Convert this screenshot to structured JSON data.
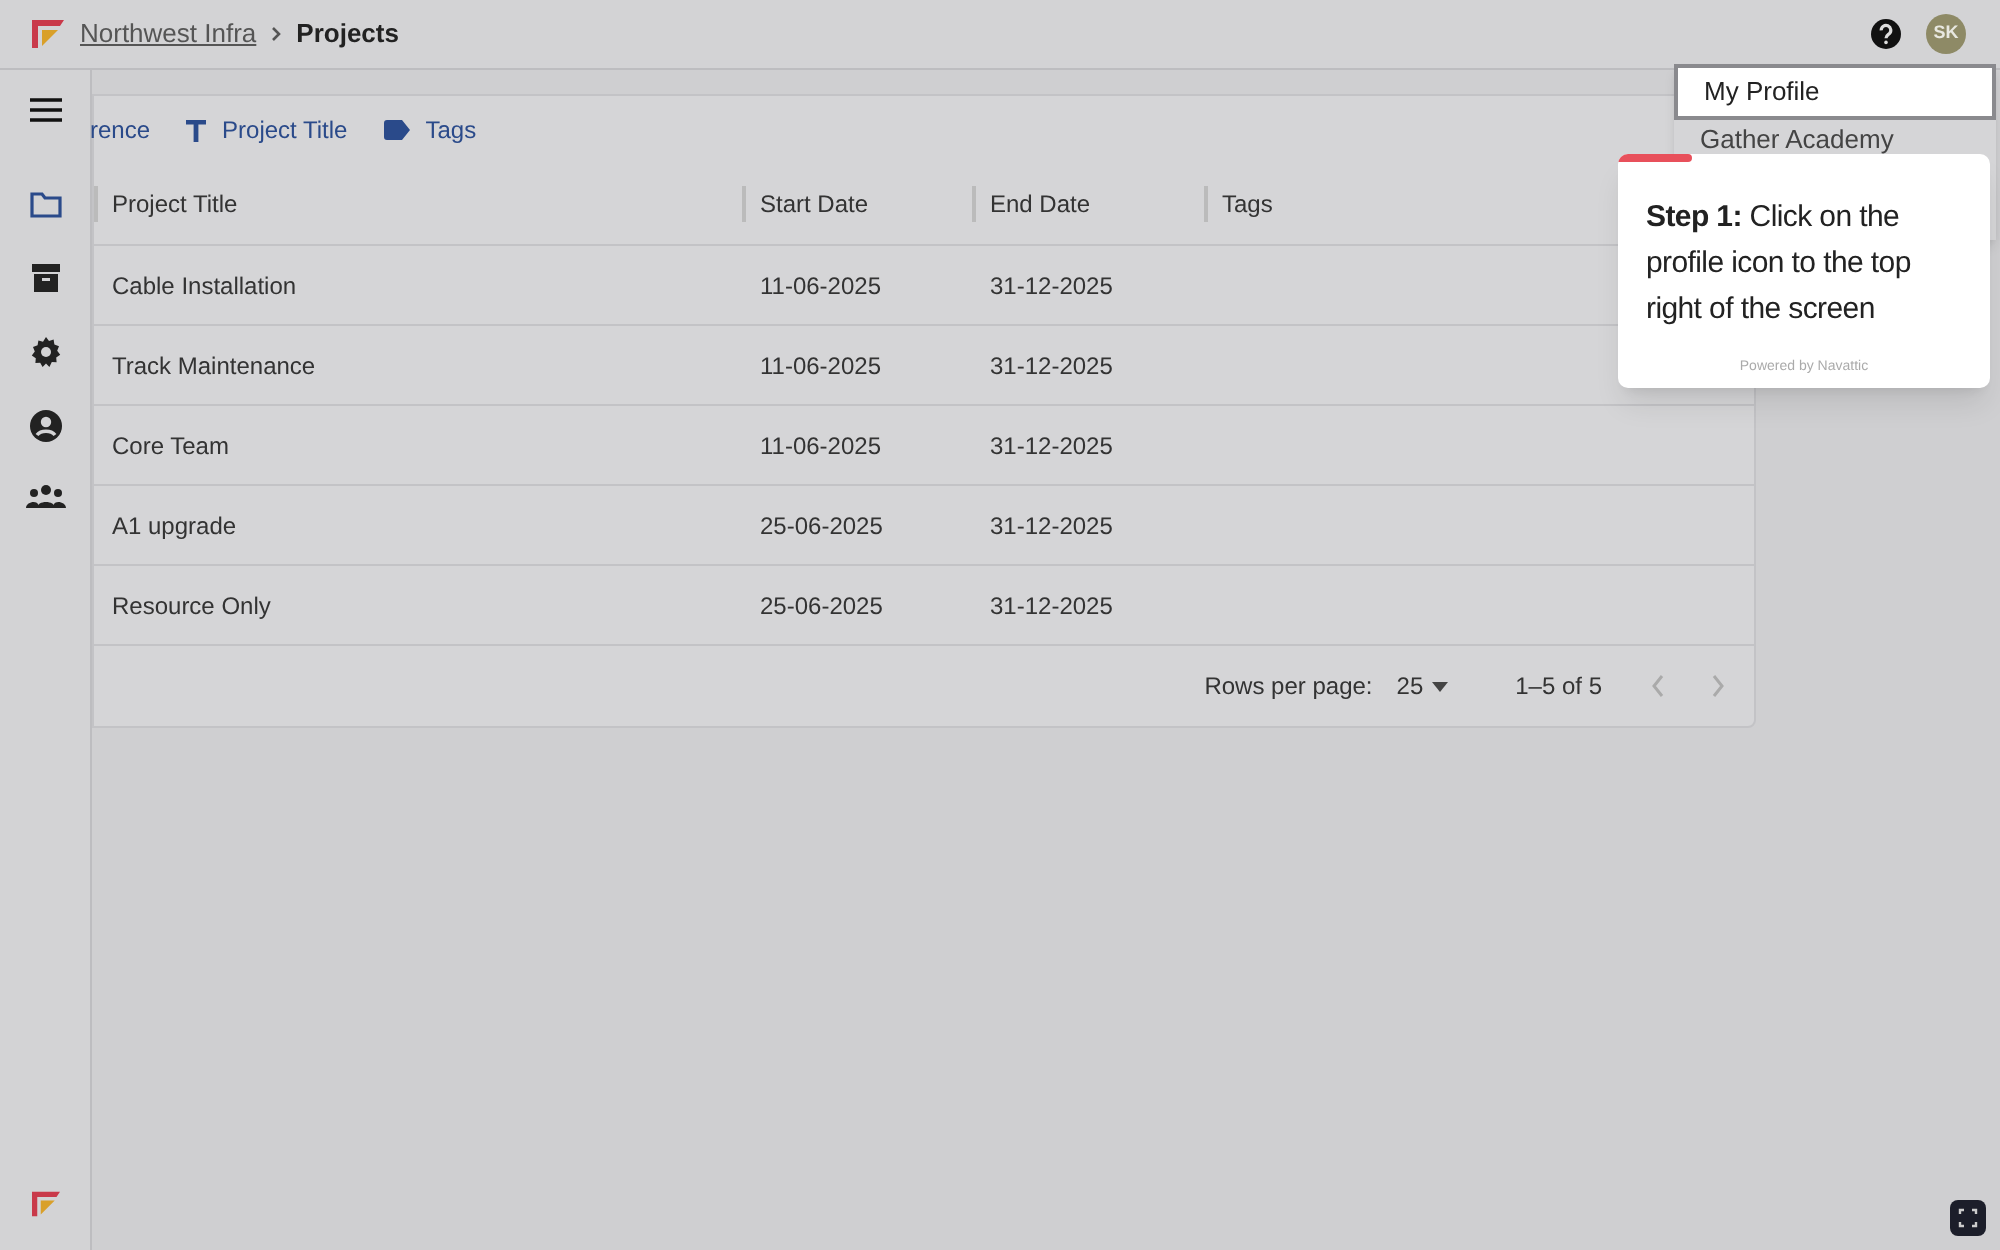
{
  "breadcrumb": [
    {
      "label": "Northwest Infra",
      "kind": "link"
    },
    {
      "label": "Projects",
      "kind": "current"
    }
  ],
  "user": {
    "initials": "SK"
  },
  "toolbar": [
    {
      "label": "rence",
      "kind": "plain"
    },
    {
      "label": "Project Title",
      "kind": "text"
    },
    {
      "label": "Tags",
      "kind": "tag"
    }
  ],
  "table": {
    "columns": [
      "Project Title",
      "Start Date",
      "End Date",
      "Tags"
    ],
    "rows": [
      [
        "Cable Installation",
        "11-06-2025",
        "31-12-2025"
      ],
      [
        "Track Maintenance",
        "11-06-2025",
        "31-12-2025"
      ],
      [
        "Core Team",
        "11-06-2025",
        "31-12-2025"
      ],
      [
        "A1 upgrade",
        "25-06-2025",
        "31-12-2025"
      ],
      [
        "Resource Only",
        "25-06-2025",
        "31-12-2025"
      ]
    ]
  },
  "pagination": {
    "rows_label": "Rows per page:",
    "rows_value": "25",
    "range": "1–5 of 5"
  },
  "profile_menu": [
    {
      "label": "My Profile",
      "selected": true
    },
    {
      "label": "Gather Academy",
      "selected": false
    }
  ],
  "tour_tip": {
    "text": "**Step 1:** Click on the profile icon to the top right of the screen",
    "footer": "Powered by Navattic",
    "progress": {
      "level": 0.2
    }
  }
}
